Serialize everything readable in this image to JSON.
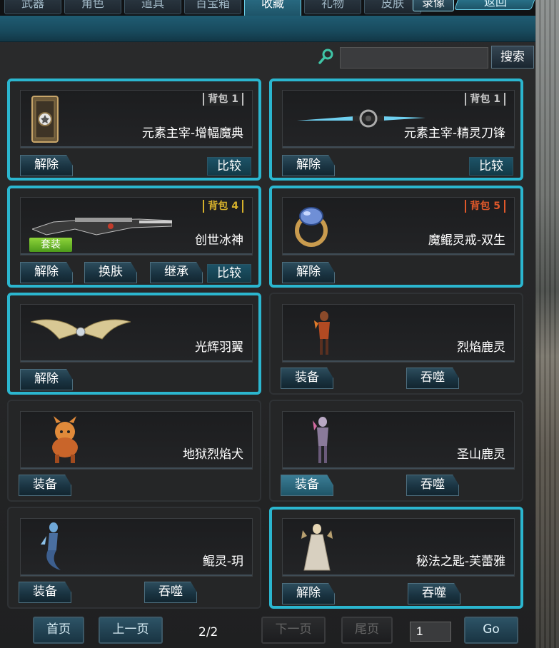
{
  "tabs": [
    {
      "label": "武器"
    },
    {
      "label": "角色"
    },
    {
      "label": "道具"
    },
    {
      "label": "百宝箱"
    },
    {
      "label": "收藏"
    },
    {
      "label": "礼物"
    },
    {
      "label": "皮肤"
    }
  ],
  "active_tab": "收藏",
  "record_button": "录像",
  "exit_button": "返回",
  "search": {
    "value": "",
    "placeholder": "",
    "button": "搜索"
  },
  "cards": [
    {
      "name": "元素主宰-增幅魔典",
      "bag": "背包 1",
      "bag_color": "grey",
      "actions": [
        "解除"
      ],
      "compare": "比较",
      "highlight": true
    },
    {
      "name": "元素主宰-精灵刀锋",
      "bag": "背包 1",
      "bag_color": "grey",
      "actions": [
        "解除"
      ],
      "compare": "比较",
      "highlight": true
    },
    {
      "name": "创世冰神",
      "bag": "背包 4",
      "bag_color": "gold",
      "set_badge": "套装",
      "actions": [
        "解除",
        "换肤",
        "继承"
      ],
      "compare": "比较",
      "highlight": true
    },
    {
      "name": "魔鲲灵戒-双生",
      "bag": "背包 5",
      "bag_color": "red",
      "actions": [
        "解除"
      ],
      "highlight": true
    },
    {
      "name": "光辉羽翼",
      "actions": [
        "解除"
      ],
      "highlight": true
    },
    {
      "name": "烈焰鹿灵",
      "actions": [
        "装备",
        "吞噬"
      ],
      "highlight": false
    },
    {
      "name": "地狱烈焰犬",
      "actions": [
        "装备"
      ],
      "highlight": false
    },
    {
      "name": "圣山鹿灵",
      "actions": [
        "装备",
        "吞噬"
      ],
      "highlight": false
    },
    {
      "name": "鲲灵-玥",
      "actions": [
        "装备",
        "吞噬"
      ],
      "highlight": false
    },
    {
      "name": "秘法之匙-芙蕾雅",
      "actions": [
        "解除",
        "吞噬"
      ],
      "highlight": true
    }
  ],
  "pagination": {
    "first": "首页",
    "prev": "上一页",
    "indicator": "2/2",
    "next": "下一页",
    "last": "尾页",
    "page_value": "1",
    "go": "Go"
  },
  "colors": {
    "accent": "#2bb6cf",
    "header": "#1f5c73",
    "set_badge": "#6cbf2a",
    "bag_gold": "#d6b12b",
    "bag_red": "#e0582a"
  }
}
